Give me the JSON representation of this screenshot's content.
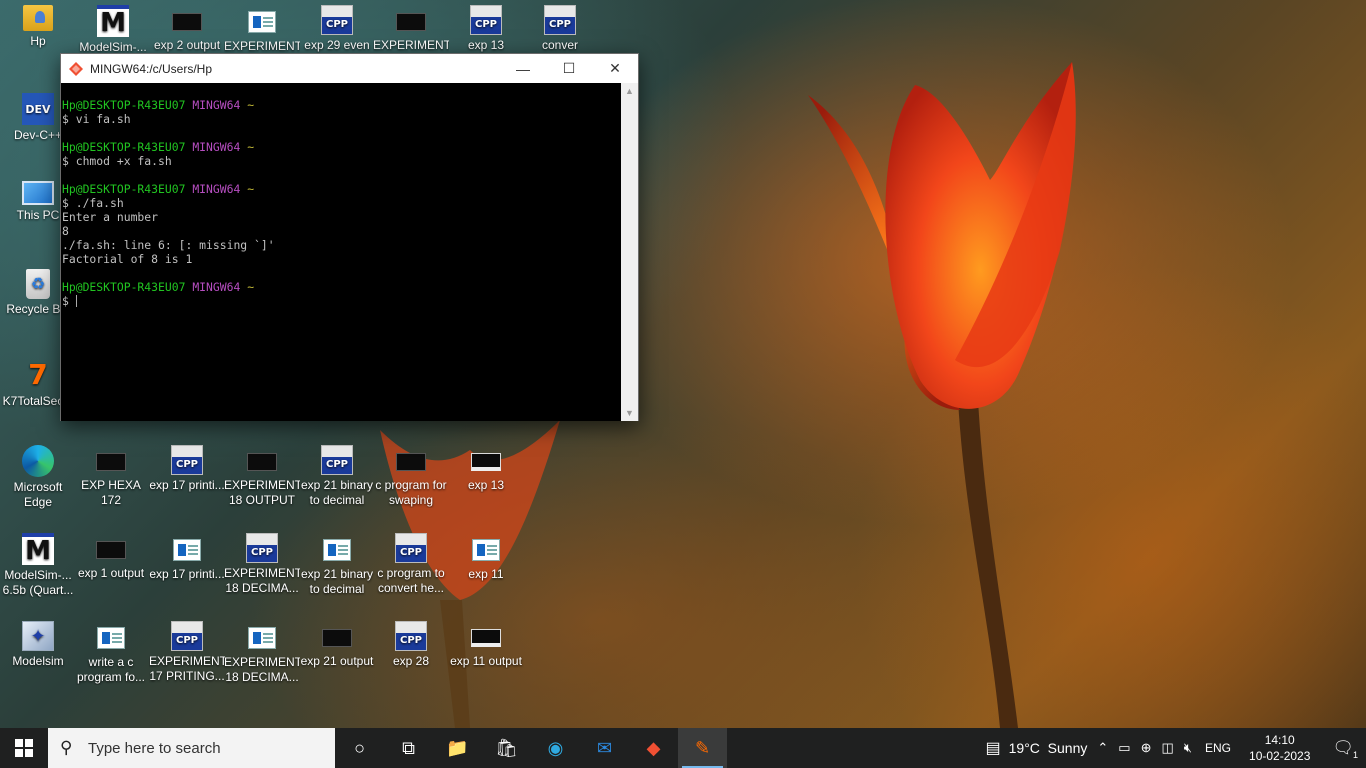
{
  "desktop": {
    "icons": [
      {
        "label": "Hp",
        "type": "folder",
        "icon": "user-folder-icon"
      },
      {
        "label": "ModelSim-...",
        "type": "msim",
        "icon": "modelsim-icon"
      },
      {
        "label": "exp 2 output",
        "type": "cmd",
        "icon": "console-output-icon"
      },
      {
        "label": "EXPERIMENT",
        "type": "doc",
        "icon": "document-icon"
      },
      {
        "label": "exp 29 even",
        "type": "cpp",
        "icon": "cpp-file-icon"
      },
      {
        "label": "EXPERIMENT",
        "type": "cmd",
        "icon": "console-output-icon"
      },
      {
        "label": "exp 13",
        "type": "cpp",
        "icon": "cpp-file-icon"
      },
      {
        "label": "conver",
        "type": "cpp",
        "icon": "cpp-file-icon"
      },
      {
        "label": "Dev-C++",
        "type": "dev",
        "icon": "devcpp-icon"
      },
      {
        "label": "This PC",
        "type": "pc",
        "icon": "computer-icon"
      },
      {
        "label": "Recycle Bin",
        "type": "bin",
        "icon": "recycle-bin-icon"
      },
      {
        "label": "K7TotalSec...",
        "type": "k7",
        "icon": "k7-security-icon"
      },
      {
        "label": "Microsoft Edge",
        "type": "edge",
        "icon": "edge-icon"
      },
      {
        "label": "EXP HEXA 172",
        "type": "cmd",
        "icon": "console-output-icon"
      },
      {
        "label": "exp 17 printi...",
        "type": "cpp",
        "icon": "cpp-file-icon"
      },
      {
        "label": "EXPERIMENT 18 OUTPUT",
        "type": "cmd",
        "icon": "console-output-icon"
      },
      {
        "label": "exp 21 binary to decimal",
        "type": "cpp",
        "icon": "cpp-file-icon"
      },
      {
        "label": "c program for swaping",
        "type": "cmd",
        "icon": "console-output-icon"
      },
      {
        "label": "exp 13",
        "type": "cmdw",
        "icon": "console-output-icon"
      },
      {
        "label": "ModelSim-... 6.5b (Quart...",
        "type": "msim",
        "icon": "modelsim-icon"
      },
      {
        "label": "exp 1 output",
        "type": "cmd",
        "icon": "console-output-icon"
      },
      {
        "label": "exp 17 printi...",
        "type": "doc",
        "icon": "document-icon"
      },
      {
        "label": "EXPERIMENT 18 DECIMA...",
        "type": "cpp",
        "icon": "cpp-file-icon"
      },
      {
        "label": "exp 21 binary to decimal",
        "type": "doc",
        "icon": "document-icon"
      },
      {
        "label": "c program to convert he...",
        "type": "cpp",
        "icon": "cpp-file-icon"
      },
      {
        "label": "exp 11",
        "type": "doc",
        "icon": "document-icon"
      },
      {
        "label": "Modelsim",
        "type": "msimw",
        "icon": "modelsim-shortcut-icon"
      },
      {
        "label": "write a c program fo...",
        "type": "doc",
        "icon": "document-icon"
      },
      {
        "label": "EXPERIMENT 17 PRITING...",
        "type": "cpp",
        "icon": "cpp-file-icon"
      },
      {
        "label": "EXPERIMENT 18 DECIMA...",
        "type": "doc",
        "icon": "document-icon"
      },
      {
        "label": "exp 21 output",
        "type": "cmd",
        "icon": "console-output-icon"
      },
      {
        "label": "exp 28",
        "type": "cpp",
        "icon": "cpp-file-icon"
      },
      {
        "label": "exp 11 output",
        "type": "cmdw",
        "icon": "console-output-icon"
      }
    ],
    "cpp_badge": "CPP",
    "dev_badge": "DEV",
    "msim_glyph": "M"
  },
  "window": {
    "title": "MINGW64:/c/Users/Hp",
    "minimize_glyph": "—",
    "maximize_glyph": "☐",
    "close_glyph": "✕",
    "prompt_user": "Hp@DESKTOP-R43EU07",
    "prompt_host": "MINGW64",
    "prompt_path": "~",
    "lines": [
      {
        "kind": "prompt"
      },
      {
        "kind": "text",
        "text": "$ vi fa.sh"
      },
      {
        "kind": "blank"
      },
      {
        "kind": "prompt"
      },
      {
        "kind": "text",
        "text": "$ chmod +x fa.sh"
      },
      {
        "kind": "blank"
      },
      {
        "kind": "prompt"
      },
      {
        "kind": "text",
        "text": "$ ./fa.sh"
      },
      {
        "kind": "text",
        "text": "Enter a number"
      },
      {
        "kind": "text",
        "text": "8"
      },
      {
        "kind": "text",
        "text": "./fa.sh: line 6: [: missing `]'"
      },
      {
        "kind": "text",
        "text": "Factorial of 8 is 1"
      },
      {
        "kind": "blank"
      },
      {
        "kind": "prompt"
      },
      {
        "kind": "cursor",
        "text": "$ "
      }
    ]
  },
  "taskbar": {
    "search_placeholder": "Type here to search",
    "apps": [
      {
        "name": "cortana",
        "glyph": "○"
      },
      {
        "name": "task-view",
        "glyph": "⧉"
      },
      {
        "name": "file-explorer",
        "glyph": "📁"
      },
      {
        "name": "microsoft-store",
        "glyph": "🛍"
      },
      {
        "name": "edge",
        "glyph": "◉"
      },
      {
        "name": "mail",
        "glyph": "✉"
      },
      {
        "name": "git-bash",
        "glyph": "◆"
      },
      {
        "name": "modelsim",
        "glyph": "✎"
      }
    ],
    "weather": "19°C  Sunny",
    "language": "ENG",
    "time": "14:10",
    "date": "10-02-2023",
    "notification_count": "1"
  },
  "colors": {
    "prompt_user": "#21c421",
    "prompt_host": "#b64ec0",
    "prompt_path": "#c6bd37",
    "taskbar_bg": "#1f2020"
  }
}
